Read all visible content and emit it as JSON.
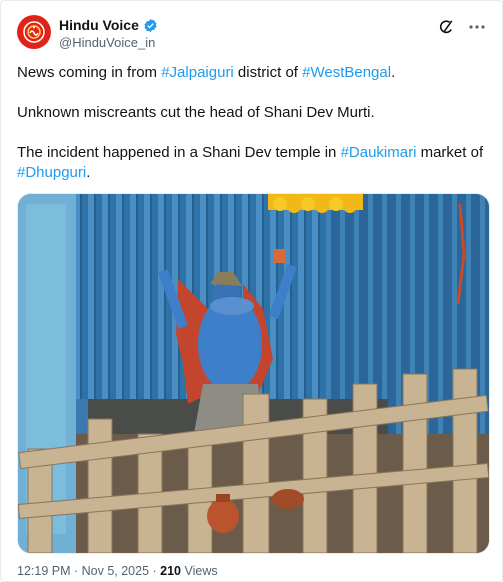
{
  "post": {
    "author": {
      "display_name": "Hindu Voice",
      "handle": "@HinduVoice_in",
      "verified": true,
      "avatar_color": "#e2231a"
    },
    "paragraph1": {
      "t1": "News coming in from ",
      "tag1": "#Jalpaiguri",
      "t2": " district of ",
      "tag2": "#WestBengal",
      "t3": "."
    },
    "paragraph2": "Unknown miscreants cut the head of Shani Dev Murti.",
    "paragraph3": {
      "t1": "The incident happened in a Shani Dev temple in ",
      "tag1": "#Daukimari",
      "t2": " market of ",
      "tag2": "#Dhupguri",
      "t3": "."
    },
    "media": {
      "icon": "photo"
    },
    "meta": {
      "time": "12:19 PM",
      "sep1": " · ",
      "date": "Nov 5, 2025",
      "sep2": " · ",
      "views_count": "210",
      "views_label": " Views"
    },
    "colors": {
      "link": "#1d9bf0",
      "text": "#0f1419",
      "secondary": "#536471",
      "verified": "#1d9bf0"
    }
  }
}
